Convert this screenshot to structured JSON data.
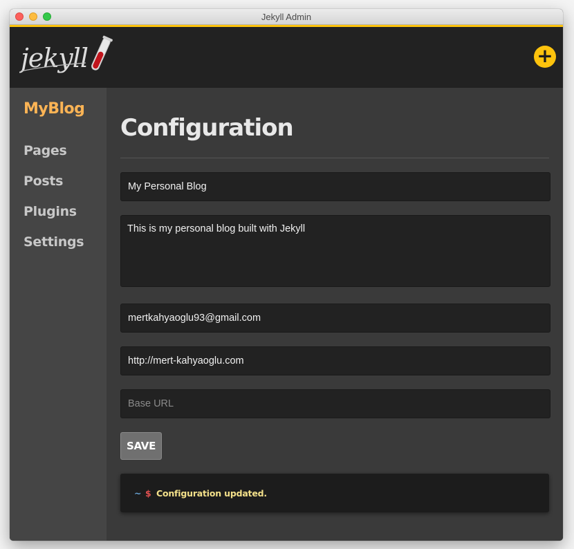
{
  "window": {
    "title": "Jekyll Admin"
  },
  "header": {
    "logo_text": "jekyll",
    "add_label": "+"
  },
  "sidebar": {
    "site_name": "MyBlog",
    "items": [
      {
        "label": "Pages"
      },
      {
        "label": "Posts"
      },
      {
        "label": "Plugins"
      },
      {
        "label": "Settings"
      }
    ]
  },
  "main": {
    "title": "Configuration",
    "fields": {
      "title": {
        "value": "My Personal Blog"
      },
      "description": {
        "value": "This is my personal blog built with Jekyll"
      },
      "email": {
        "value": "mertkahyaoglu93@gmail.com"
      },
      "url": {
        "value": "http://mert-kahyaoglu.com"
      },
      "baseurl": {
        "value": "",
        "placeholder": "Base URL"
      }
    },
    "save_label": "SAVE",
    "notification": {
      "tilde": "~",
      "dollar": "$",
      "message": "Configuration updated."
    }
  },
  "colors": {
    "accent": "#fdc30d",
    "site_name": "#fcb455",
    "notification_text": "#f3e08a",
    "header_bg": "#222222",
    "sidebar_bg": "#454545",
    "main_bg": "#3a3a3a"
  },
  "icons": [
    "close-light",
    "minimize-light",
    "maximize-light",
    "add-icon",
    "jekyll-logo",
    "test-tube-icon"
  ]
}
